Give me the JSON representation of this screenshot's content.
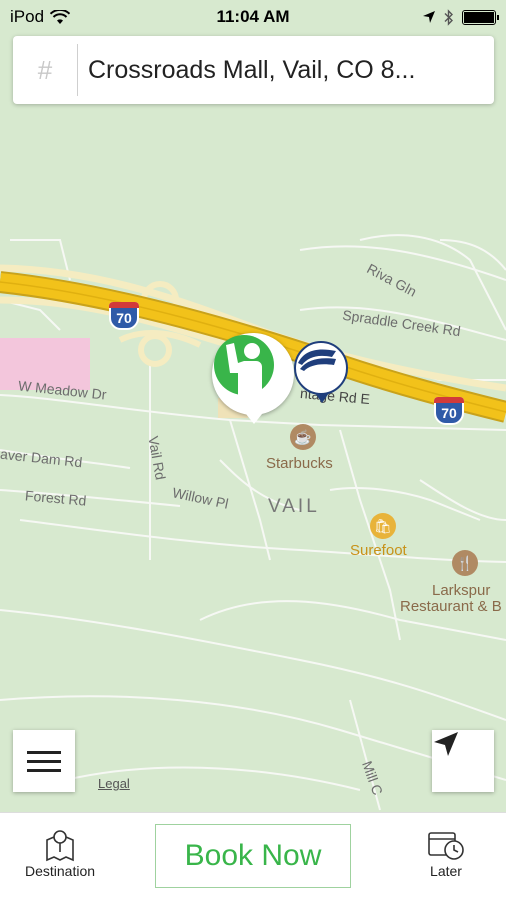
{
  "status_bar": {
    "carrier": "iPod",
    "time": "11:04 AM"
  },
  "search": {
    "hash_symbol": "#",
    "address": "Crossroads Mall, Vail, CO  8..."
  },
  "map": {
    "labels": {
      "riva_gln": "Riva Gln",
      "spraddle_creek": "Spraddle Creek Rd",
      "w_meadow": "W Meadow Dr",
      "frontage": "ntage Rd E",
      "beaver_dam": "aver Dam Rd",
      "forest": "Forest Rd",
      "vail_rd": "Vail Rd",
      "willow": "Willow Pl",
      "town": "VAIL",
      "mill_creek": "Mill C"
    },
    "highway": "70",
    "pois": {
      "starbucks": "Starbucks",
      "surefoot": "Surefoot",
      "larkspur_1": "Larkspur",
      "larkspur_2": "Restaurant & B"
    },
    "legal": "Legal",
    "colors": {
      "background": "#d7e9cf",
      "highway": "#f2c21a",
      "pickup": "#39b54a",
      "taxi": "#1f3e7c"
    }
  },
  "controls": {
    "menu_icon": "hamburger-menu-icon",
    "locate_icon": "location-arrow-icon"
  },
  "bottom_bar": {
    "destination_label": "Destination",
    "book_label": "Book Now",
    "later_label": "Later"
  }
}
